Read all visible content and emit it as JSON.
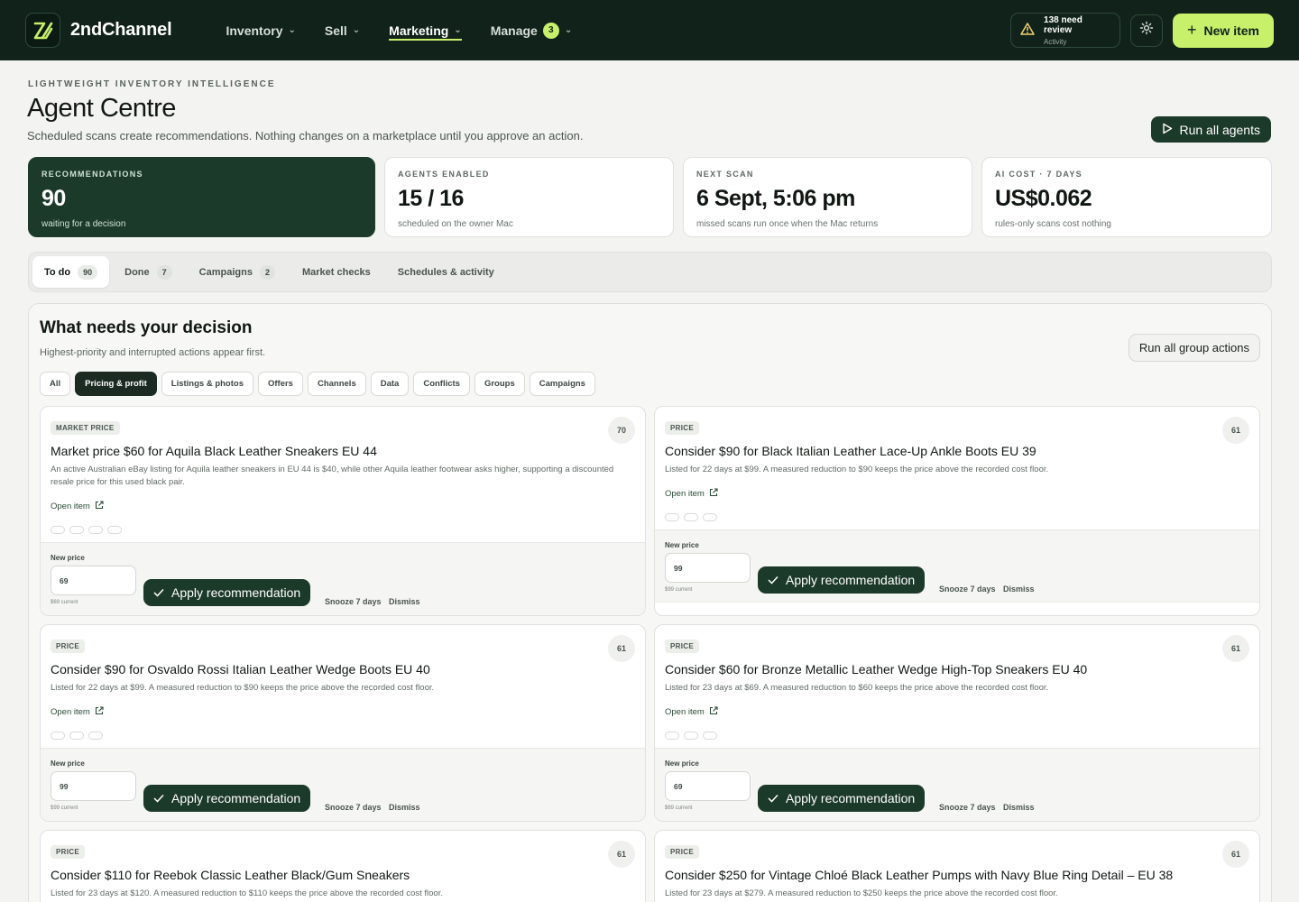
{
  "app": {
    "name": "2ndChannel",
    "nav": [
      {
        "label": "Inventory",
        "active": false
      },
      {
        "label": "Sell",
        "active": false
      },
      {
        "label": "Marketing",
        "active": true
      },
      {
        "label": "Manage",
        "active": false,
        "badge": "3"
      }
    ],
    "review": {
      "title": "138 need review",
      "subtitle": "Activity"
    },
    "new_item_label": "New item",
    "colors": {
      "brand_dark": "#10221a",
      "accent": "#c8f06b",
      "primary": "#1c3a2a"
    }
  },
  "header": {
    "eyebrow": "LIGHTWEIGHT INVENTORY INTELLIGENCE",
    "title": "Agent Centre",
    "subtitle": "Scheduled scans create recommendations. Nothing changes on a marketplace until you approve an action.",
    "run_all_label": "Run all agents"
  },
  "stats": [
    {
      "label": "RECOMMENDATIONS",
      "value": "90",
      "note": "waiting for a decision"
    },
    {
      "label": "AGENTS ENABLED",
      "value": "15 / 16",
      "note": "scheduled on the owner Mac"
    },
    {
      "label": "NEXT SCAN",
      "value": "6 Sept, 5:06 pm",
      "note": "missed scans run once when the Mac returns"
    },
    {
      "label": "AI COST · 7 DAYS",
      "value": "US$0.062",
      "note": "rules-only scans cost nothing"
    }
  ],
  "tabs": [
    {
      "label": "To do",
      "count": "90"
    },
    {
      "label": "Done",
      "count": "7"
    },
    {
      "label": "Campaigns",
      "count": "2"
    },
    {
      "label": "Market checks",
      "count": ""
    },
    {
      "label": "Schedules & activity",
      "count": ""
    }
  ],
  "decision": {
    "title": "What needs your decision",
    "subtitle": "Highest-priority and interrupted actions appear first.",
    "group_actions_label": "Run all group actions",
    "filters": [
      "All",
      "Pricing & profit",
      "Listings & photos",
      "Offers",
      "Channels",
      "Data",
      "Conflicts",
      "Groups",
      "Campaigns"
    ],
    "active_filter": "Pricing & profit",
    "card_labels": {
      "open_item": "Open item",
      "new_price": "New price",
      "apply": "Apply recommendation",
      "snooze": "Snooze 7 days",
      "dismiss": "Dismiss"
    },
    "cards": [
      {
        "tag": "MARKET PRICE",
        "score": "70",
        "title": "Market price $60 for Aquila Black Leather Sneakers EU 44",
        "description": "An active Australian eBay listing for Aquila leather sneakers in EU 44 is $40, while other Aquila leather footwear asks higher, supporting a discounted resale price for this used black pair.",
        "new_price": "69",
        "current": "$69 current"
      },
      {
        "tag": "PRICE",
        "score": "61",
        "title": "Consider $90 for Black Italian Leather Lace-Up Ankle Boots EU 39",
        "description": "Listed for 22 days at $99. A measured reduction to $90 keeps the price above the recorded cost floor.",
        "new_price": "99",
        "current": "$99 current"
      },
      {
        "tag": "PRICE",
        "score": "61",
        "title": "Consider $90 for Osvaldo Rossi Italian Leather Wedge Boots EU 40",
        "description": "Listed for 22 days at $99. A measured reduction to $90 keeps the price above the recorded cost floor.",
        "new_price": "99",
        "current": "$99 current"
      },
      {
        "tag": "PRICE",
        "score": "61",
        "title": "Consider $60 for Bronze Metallic Leather Wedge High-Top Sneakers EU 40",
        "description": "Listed for 23 days at $69. A measured reduction to $60 keeps the price above the recorded cost floor.",
        "new_price": "69",
        "current": "$69 current"
      },
      {
        "tag": "PRICE",
        "score": "61",
        "title": "Consider $110 for Reebok Classic Leather Black/Gum Sneakers",
        "description": "Listed for 23 days at $120. A measured reduction to $110 keeps the price above the recorded cost floor."
      },
      {
        "tag": "PRICE",
        "score": "61",
        "title": "Consider $250 for Vintage Chloé Black Leather Pumps with Navy Blue Ring Detail – EU 38",
        "description": "Listed for 23 days at $279. A measured reduction to $250 keeps the price above the recorded cost floor."
      }
    ]
  }
}
